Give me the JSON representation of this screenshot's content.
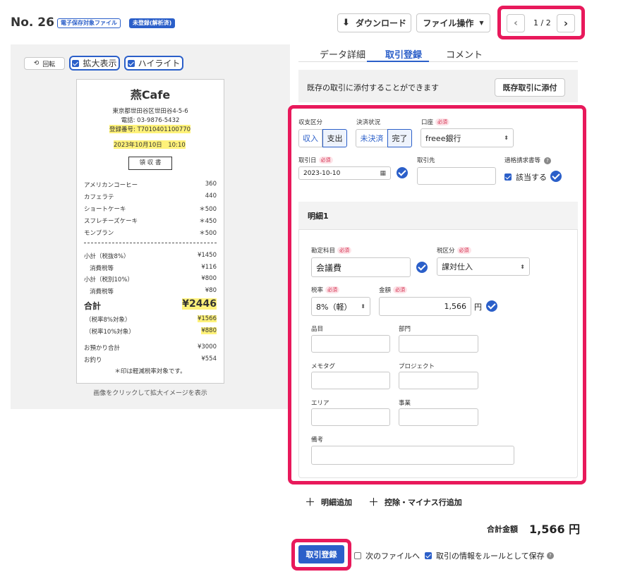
{
  "header": {
    "title": "No. 26",
    "badge_e_storage": "電子保存対象ファイル",
    "badge_unregistered": "未登録(解析済)",
    "download_label": "ダウンロード",
    "file_ops_label": "ファイル操作",
    "pager_text": "1 / 2"
  },
  "viewer": {
    "rotate_label": "回転",
    "zoom_label": "拡大表示",
    "highlight_label": "ハイライト",
    "hint": "画像をクリックして拡大イメージを表示"
  },
  "receipt": {
    "shop": "燕Cafe",
    "address": "東京都世田谷区世田谷4-5-6",
    "phone": "電話: 03-9876-5432",
    "reg_no": "登録番号: T7010401100770",
    "datetime": "2023年10月10日　10:10",
    "doc_title": "領 収 書",
    "items": [
      {
        "name": "アメリカンコーヒー",
        "price": "360"
      },
      {
        "name": "カフェラテ",
        "price": "440"
      },
      {
        "name": "ショートケーキ",
        "price": "＊500"
      },
      {
        "name": "スフレチーズケーキ",
        "price": "＊450"
      },
      {
        "name": "モンブラン",
        "price": "＊500"
      }
    ],
    "subtotal8_label": "小計（税抜8%）",
    "subtotal8": "¥1450",
    "tax8_label": "消費税等",
    "tax8": "¥116",
    "subtotal10_label": "小計（税別10%）",
    "subtotal10": "¥800",
    "tax10_label": "消費税等",
    "tax10": "¥80",
    "total_label": "合計",
    "total": "¥2446",
    "target8_label": "（税率8%対象）",
    "target8": "¥1566",
    "target10_label": "（税率10%対象）",
    "target10": "¥880",
    "received_label": "お預かり合計",
    "received": "¥3000",
    "change_label": "お釣り",
    "change": "¥554",
    "note": "＊印は軽減税率対象です。"
  },
  "tabs": {
    "detail": "データ詳細",
    "register": "取引登録",
    "comment": "コメント"
  },
  "attach": {
    "text": "既存の取引に添付することができます",
    "button": "既存取引に添付"
  },
  "form": {
    "required": "必須",
    "income_type_label": "収支区分",
    "income": "収入",
    "expense": "支出",
    "settle_label": "決済状況",
    "unsettled": "未決済",
    "settled": "完了",
    "account_label": "口座",
    "account_value": "freee銀行",
    "date_label": "取引日",
    "date_value": "2023-10-10",
    "partner_label": "取引先",
    "partner_value": "",
    "invoice_label": "適格請求書等",
    "invoice_check": "該当する",
    "detail_title": "明細1",
    "subject_label": "勘定科目",
    "subject_value": "会議費",
    "tax_cat_label": "税区分",
    "tax_cat_value": "課対仕入",
    "tax_rate_label": "税率",
    "tax_rate_value": "8%（軽）",
    "amount_label": "金額",
    "amount_value": "1,566",
    "yen": "円",
    "item_label": "品目",
    "dept_label": "部門",
    "memo_label": "メモタグ",
    "project_label": "プロジェクト",
    "area_label": "エリア",
    "business_label": "事業",
    "note_label": "備考"
  },
  "actions": {
    "add_detail": "明細追加",
    "add_deduction": "控除・マイナス行追加",
    "total_label": "合計金額",
    "total_value": "1,566 円",
    "register_button": "取引登録",
    "next_file": "次のファイルへ",
    "save_rule": "取引の情報をルールとして保存"
  },
  "colors": {
    "accent": "#2b5fc9",
    "highlight": "#e8195b",
    "receipt_highlight": "#fff27a"
  }
}
